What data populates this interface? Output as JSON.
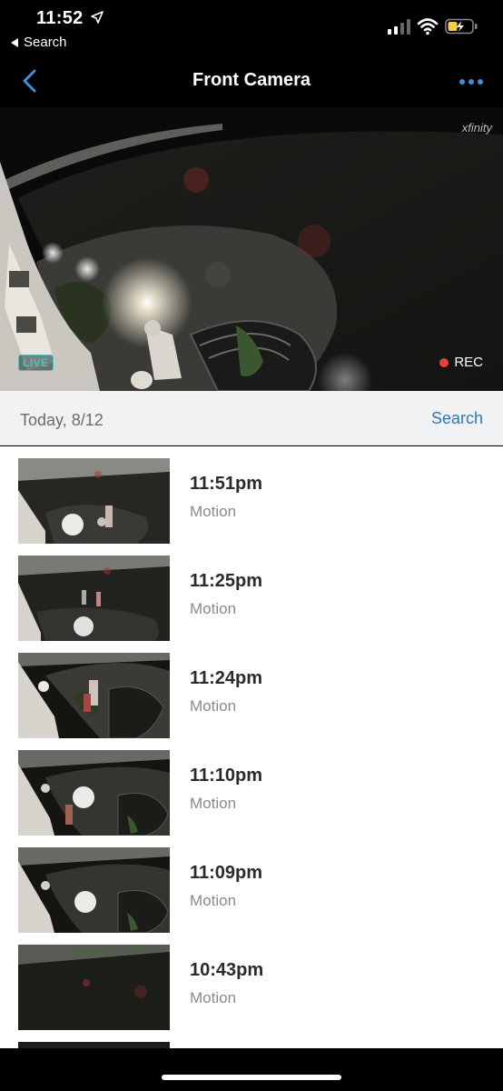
{
  "status_bar": {
    "time": "11:52",
    "back_app_label": "Search"
  },
  "nav": {
    "title": "Front Camera"
  },
  "live": {
    "brand": "xfinity",
    "live_label": "LIVE",
    "rec_label": "REC",
    "rec_color": "#e7433b",
    "live_color": "#46c3c0"
  },
  "date_header": {
    "date": "Today, 8/12",
    "search_label": "Search"
  },
  "events": [
    {
      "time": "11:51pm",
      "type": "Motion"
    },
    {
      "time": "11:25pm",
      "type": "Motion"
    },
    {
      "time": "11:24pm",
      "type": "Motion"
    },
    {
      "time": "11:10pm",
      "type": "Motion"
    },
    {
      "time": "11:09pm",
      "type": "Motion"
    },
    {
      "time": "10:43pm",
      "type": "Motion"
    }
  ],
  "colors": {
    "accent": "#2c77b8",
    "header_bg": "#f1f2f4"
  }
}
